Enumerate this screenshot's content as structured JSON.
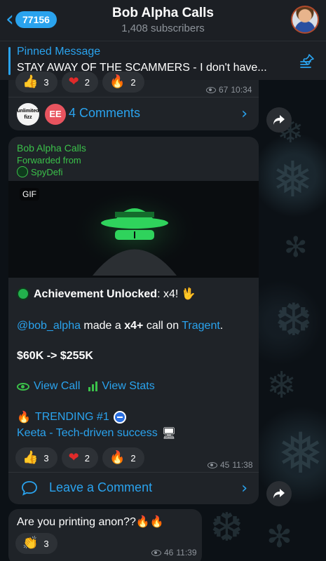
{
  "header": {
    "back_count": "77156",
    "title": "Bob Alpha Calls",
    "subtitle": "1,408 subscribers"
  },
  "pinned": {
    "label": "Pinned Message",
    "text": "STAY AWAY OF THE SCAMMERS - I don't have..."
  },
  "post1": {
    "reactions": [
      {
        "emoji": "👍",
        "count": "3"
      },
      {
        "emoji": "❤",
        "count": "2"
      },
      {
        "emoji": "🔥",
        "count": "2"
      }
    ],
    "views": "67",
    "time": "10:34",
    "comments_label": "4 Comments",
    "commenter_avatar_1": "unlimited fizz",
    "commenter_avatar_2": "EE"
  },
  "post2": {
    "sender": "Bob Alpha Calls",
    "forwarded_label": "Forwarded from",
    "forwarded_source": "SpyDefi",
    "gif_badge": "GIF",
    "achievement_bold": "Achievement Unlocked",
    "achievement_rest": ": x4! ",
    "achievement_emoji": "🖖",
    "mention": "@bob_alpha",
    "made_text": " made a ",
    "call_bold": "x4+",
    "call_on": " call on ",
    "token_link": "Tragent",
    "token_end": ".",
    "price_line": "$60K -> $255K",
    "view_call": "View Call",
    "view_stats": "View Stats",
    "trending_label": "TRENDING #1",
    "trending_fire": "🔥",
    "keeta_line": "Keeta - Tech-driven success",
    "keeta_icon": "🖥",
    "reactions": [
      {
        "emoji": "👍",
        "count": "3"
      },
      {
        "emoji": "❤",
        "count": "2"
      },
      {
        "emoji": "🔥",
        "count": "2"
      }
    ],
    "views": "45",
    "time": "11:38",
    "comment_label": "Leave a Comment"
  },
  "post3": {
    "text": "Are you printing anon??",
    "emojis": "🔥🔥",
    "reaction": {
      "emoji": "👏",
      "count": "3"
    },
    "views": "46",
    "time": "11:39"
  },
  "colors": {
    "accent": "#2aa3ee",
    "green": "#3bc14a",
    "bubble": "#1f2328",
    "header": "#1c1f24"
  }
}
